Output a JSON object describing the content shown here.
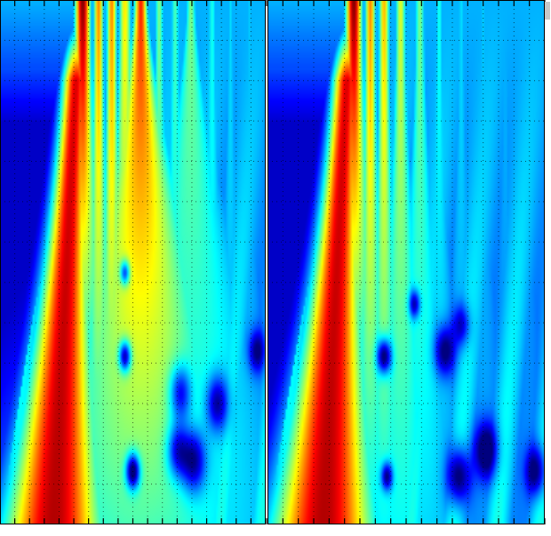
{
  "colormap": [
    "#00007f",
    "#0000ff",
    "#007fff",
    "#00ffff",
    "#7fff7f",
    "#ffff00",
    "#ff7f00",
    "#ff0000",
    "#7f0000"
  ],
  "colors": {
    "frame": "#000000",
    "grid_dot": "#000000",
    "background": "#ffffff"
  },
  "chart_data": [
    {
      "type": "heatmap",
      "title": "",
      "xlabel": "",
      "ylabel": "",
      "grid": true,
      "xtick_count": 18,
      "ytick_count": 13,
      "value_range": [
        0,
        1
      ],
      "ridges": [
        {
          "x": 0.31,
          "w": 0.03,
          "a": 0.95,
          "k": 0.2,
          "exp": 2,
          "d": 0.9
        },
        {
          "x": 0.37,
          "w": 0.02,
          "a": 0.7,
          "k": 0.1,
          "exp": 2,
          "d": 0.55
        },
        {
          "x": 0.42,
          "w": 0.02,
          "a": 0.7,
          "k": 0.1,
          "exp": 2,
          "d": 0.5
        },
        {
          "x": 0.47,
          "w": 0.025,
          "a": 0.6,
          "k": 0.25,
          "exp": 2,
          "d": 0.45
        },
        {
          "x": 0.53,
          "w": 0.025,
          "a": 0.8,
          "k": 0.55,
          "exp": 1.5,
          "d": 0.5
        },
        {
          "x": 0.6,
          "w": 0.018,
          "a": 0.45,
          "k": 0.2,
          "exp": 2,
          "d": 0.35
        },
        {
          "x": 0.66,
          "w": 0.018,
          "a": 0.4,
          "k": 0.2,
          "exp": 2,
          "d": 0.3
        },
        {
          "x": 0.72,
          "w": 0.02,
          "a": 0.45,
          "k": 0.6,
          "exp": 1.5,
          "d": 0.3
        },
        {
          "x": 0.8,
          "w": 0.018,
          "a": 0.35,
          "k": 0.2,
          "exp": 2,
          "d": 0.25
        },
        {
          "x": 0.87,
          "w": 0.015,
          "a": 0.3,
          "k": 0.2,
          "exp": 2,
          "d": 0.2
        },
        {
          "x": 0.94,
          "w": 0.015,
          "a": 0.28,
          "k": 0.2,
          "exp": 2,
          "d": 0.2
        }
      ],
      "holes": [
        {
          "x": 0.47,
          "y": 0.52,
          "r": 0.018,
          "a": 0.4
        },
        {
          "x": 0.47,
          "y": 0.68,
          "r": 0.022,
          "a": 0.5
        },
        {
          "x": 0.68,
          "y": 0.75,
          "r": 0.04,
          "a": 0.35
        },
        {
          "x": 0.82,
          "y": 0.77,
          "r": 0.04,
          "a": 0.35
        },
        {
          "x": 0.67,
          "y": 0.86,
          "r": 0.04,
          "a": 0.35
        },
        {
          "x": 0.73,
          "y": 0.88,
          "r": 0.045,
          "a": 0.4
        },
        {
          "x": 0.5,
          "y": 0.9,
          "r": 0.025,
          "a": 0.55
        },
        {
          "x": 0.97,
          "y": 0.67,
          "r": 0.03,
          "a": 0.3
        }
      ]
    },
    {
      "type": "heatmap",
      "title": "",
      "xlabel": "",
      "ylabel": "",
      "grid": true,
      "xtick_count": 18,
      "ytick_count": 13,
      "value_range": [
        0,
        1
      ],
      "ridges": [
        {
          "x": 0.31,
          "w": 0.03,
          "a": 0.95,
          "k": 0.2,
          "exp": 2,
          "d": 0.9
        },
        {
          "x": 0.37,
          "w": 0.02,
          "a": 0.7,
          "k": 0.1,
          "exp": 2,
          "d": 0.55
        },
        {
          "x": 0.42,
          "w": 0.02,
          "a": 0.65,
          "k": 0.1,
          "exp": 2,
          "d": 0.5
        },
        {
          "x": 0.48,
          "w": 0.02,
          "a": 0.55,
          "k": 0.2,
          "exp": 2,
          "d": 0.4
        },
        {
          "x": 0.55,
          "w": 0.02,
          "a": 0.45,
          "k": 0.25,
          "exp": 2,
          "d": 0.35
        },
        {
          "x": 0.62,
          "w": 0.016,
          "a": 0.35,
          "k": 0.2,
          "exp": 2,
          "d": 0.3
        },
        {
          "x": 0.7,
          "w": 0.016,
          "a": 0.3,
          "k": 0.2,
          "exp": 2,
          "d": 0.25
        },
        {
          "x": 0.78,
          "w": 0.016,
          "a": 0.28,
          "k": 0.2,
          "exp": 2,
          "d": 0.22
        },
        {
          "x": 0.86,
          "w": 0.015,
          "a": 0.26,
          "k": 0.2,
          "exp": 2,
          "d": 0.2
        },
        {
          "x": 0.94,
          "w": 0.015,
          "a": 0.25,
          "k": 0.2,
          "exp": 2,
          "d": 0.2
        }
      ],
      "holes": [
        {
          "x": 0.42,
          "y": 0.68,
          "r": 0.025,
          "a": 0.5
        },
        {
          "x": 0.53,
          "y": 0.58,
          "r": 0.02,
          "a": 0.35
        },
        {
          "x": 0.43,
          "y": 0.91,
          "r": 0.02,
          "a": 0.4
        },
        {
          "x": 0.64,
          "y": 0.67,
          "r": 0.035,
          "a": 0.35
        },
        {
          "x": 0.69,
          "y": 0.91,
          "r": 0.04,
          "a": 0.4
        },
        {
          "x": 0.79,
          "y": 0.86,
          "r": 0.04,
          "a": 0.4
        },
        {
          "x": 0.7,
          "y": 0.62,
          "r": 0.03,
          "a": 0.25
        },
        {
          "x": 0.97,
          "y": 0.9,
          "r": 0.035,
          "a": 0.35
        }
      ]
    }
  ]
}
